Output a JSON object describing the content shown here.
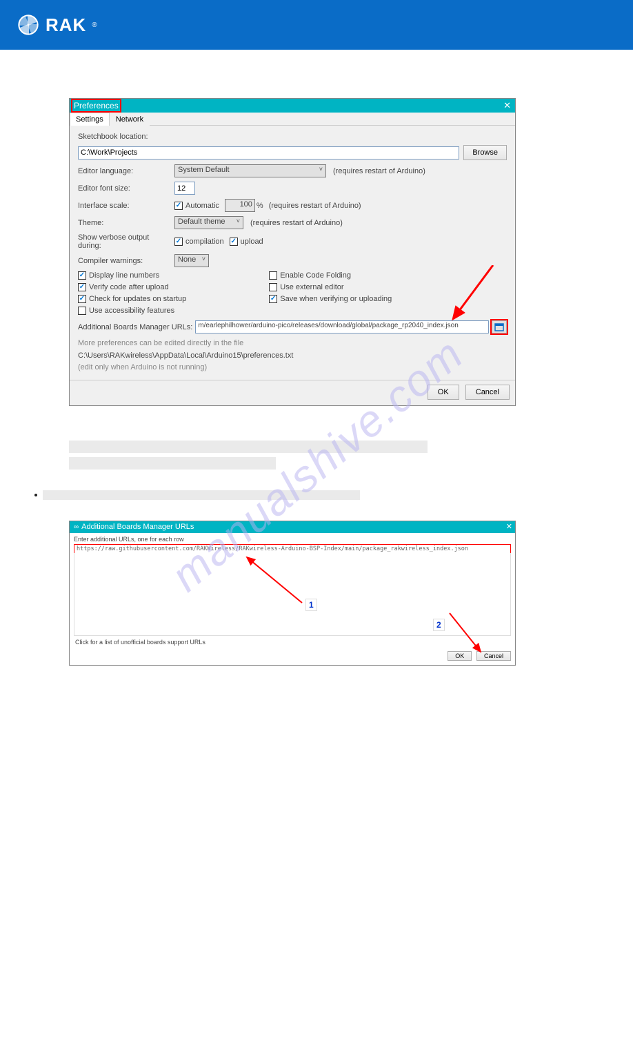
{
  "header": {
    "brand": "RAK",
    "reg": "®"
  },
  "pref": {
    "title": "Preferences",
    "tabs": {
      "settings": "Settings",
      "network": "Network"
    },
    "sketchbook_label": "Sketchbook location:",
    "sketchbook_value": "C:\\Work\\Projects",
    "browse": "Browse",
    "editor_lang_label": "Editor language:",
    "editor_lang_value": "System Default",
    "editor_lang_note": "(requires restart of Arduino)",
    "font_size_label": "Editor font size:",
    "font_size_value": "12",
    "scale_label": "Interface scale:",
    "scale_auto": "Automatic",
    "scale_value": "100",
    "scale_unit": "%",
    "scale_note": "(requires restart of Arduino)",
    "theme_label": "Theme:",
    "theme_value": "Default theme",
    "theme_note": "(requires restart of Arduino)",
    "verbose_label": "Show verbose output during:",
    "verbose_compile": "compilation",
    "verbose_upload": "upload",
    "warnings_label": "Compiler warnings:",
    "warnings_value": "None",
    "chk_line_numbers": "Display line numbers",
    "chk_verify_upload": "Verify code after upload",
    "chk_check_updates": "Check for updates on startup",
    "chk_accessibility": "Use accessibility features",
    "chk_code_fold": "Enable Code Folding",
    "chk_ext_editor": "Use external editor",
    "chk_save_verify": "Save when verifying or uploading",
    "addl_label": "Additional Boards Manager URLs:",
    "addl_value": "m/earlephilhower/arduino-pico/releases/download/global/package_rp2040_index.json",
    "more_prefs": "More preferences can be edited directly in the file",
    "prefs_path": "C:\\Users\\RAKwireless\\AppData\\Local\\Arduino15\\preferences.txt",
    "edit_note": "(edit only when Arduino is not running)",
    "ok": "OK",
    "cancel": "Cancel"
  },
  "dlg2": {
    "title": "Additional Boards Manager URLs",
    "hint": "Enter additional URLs, one for each row",
    "url": "https://raw.githubusercontent.com/RAKWireless/RAKwireless-Arduino-BSP-Index/main/package_rakwireless_index.json",
    "link": "Click for a list of unofficial boards support URLs",
    "ok": "OK",
    "cancel": "Cancel",
    "num1": "1",
    "num2": "2"
  },
  "watermark": "manualshive.com"
}
